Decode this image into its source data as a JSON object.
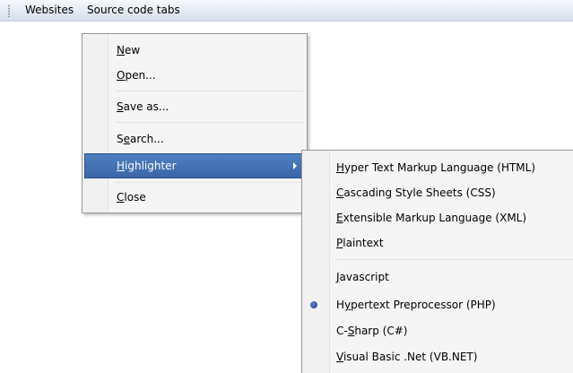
{
  "menubar": {
    "items": [
      {
        "label": "Websites"
      },
      {
        "label": "Source code tabs"
      }
    ]
  },
  "main_menu": {
    "items": [
      {
        "pre": "",
        "u": "N",
        "post": "ew"
      },
      {
        "pre": "",
        "u": "O",
        "post": "pen..."
      },
      {
        "pre": "",
        "u": "S",
        "post": "ave as..."
      },
      {
        "pre": "S",
        "u": "e",
        "post": "arch..."
      },
      {
        "pre": "",
        "u": "H",
        "post": "ighlighter"
      },
      {
        "pre": "",
        "u": "C",
        "post": "lose"
      }
    ]
  },
  "highlighter_menu": {
    "selected": "Hypertext Preprocessor (PHP)",
    "items": [
      {
        "pre": "",
        "u": "H",
        "post": "yper Text Markup Language (HTML)"
      },
      {
        "pre": "",
        "u": "C",
        "post": "ascading Style Sheets (CSS)"
      },
      {
        "pre": "",
        "u": "E",
        "post": "xtensible Markup Language (XML)"
      },
      {
        "pre": "",
        "u": "P",
        "post": "laintext"
      },
      {
        "pre": "",
        "u": "J",
        "post": "avascript"
      },
      {
        "pre": "H",
        "u": "y",
        "post": "pertext Preprocessor (PHP)"
      },
      {
        "pre": "C-",
        "u": "S",
        "post": "harp (C#)"
      },
      {
        "pre": "",
        "u": "V",
        "post": "isual Basic .Net (VB.NET)"
      }
    ]
  }
}
